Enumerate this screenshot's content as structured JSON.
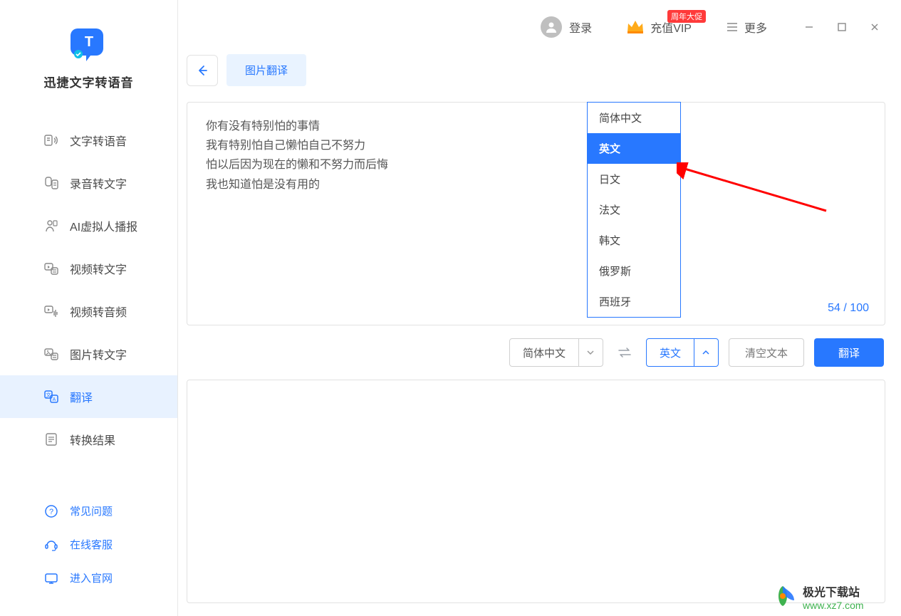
{
  "app": {
    "title": "迅捷文字转语音"
  },
  "sidebar": {
    "items": [
      {
        "label": "文字转语音",
        "icon": "text-to-speech-icon"
      },
      {
        "label": "录音转文字",
        "icon": "audio-to-text-icon"
      },
      {
        "label": "AI虚拟人播报",
        "icon": "ai-avatar-icon"
      },
      {
        "label": "视频转文字",
        "icon": "video-to-text-icon"
      },
      {
        "label": "视频转音频",
        "icon": "video-to-audio-icon"
      },
      {
        "label": "图片转文字",
        "icon": "image-to-text-icon"
      },
      {
        "label": "翻译",
        "icon": "translate-icon",
        "active": true
      },
      {
        "label": "转换结果",
        "icon": "results-icon"
      }
    ],
    "footer": [
      {
        "label": "常见问题",
        "icon": "faq-icon"
      },
      {
        "label": "在线客服",
        "icon": "support-icon"
      },
      {
        "label": "进入官网",
        "icon": "website-icon"
      }
    ]
  },
  "topbar": {
    "login": "登录",
    "vip": "充值VIP",
    "vip_badge": "周年大促",
    "more": "更多"
  },
  "tab": {
    "label": "图片翻译"
  },
  "input": {
    "text": "你有没有特别怕的事情\n我有特别怕自己懒怕自己不努力\n怕以后因为现在的懒和不努力而后悔\n我也知道怕是没有用的",
    "count_current": "54",
    "count_sep": " / ",
    "count_max": "100"
  },
  "dropdown": {
    "options": [
      "简体中文",
      "英文",
      "日文",
      "法文",
      "韩文",
      "俄罗斯",
      "西班牙"
    ],
    "selected_index": 1
  },
  "controls": {
    "source_lang": "简体中文",
    "target_lang": "英文",
    "clear": "清空文本",
    "translate": "翻译"
  },
  "watermark": {
    "brand": "极光下载站",
    "url": "www.xz7.com"
  }
}
